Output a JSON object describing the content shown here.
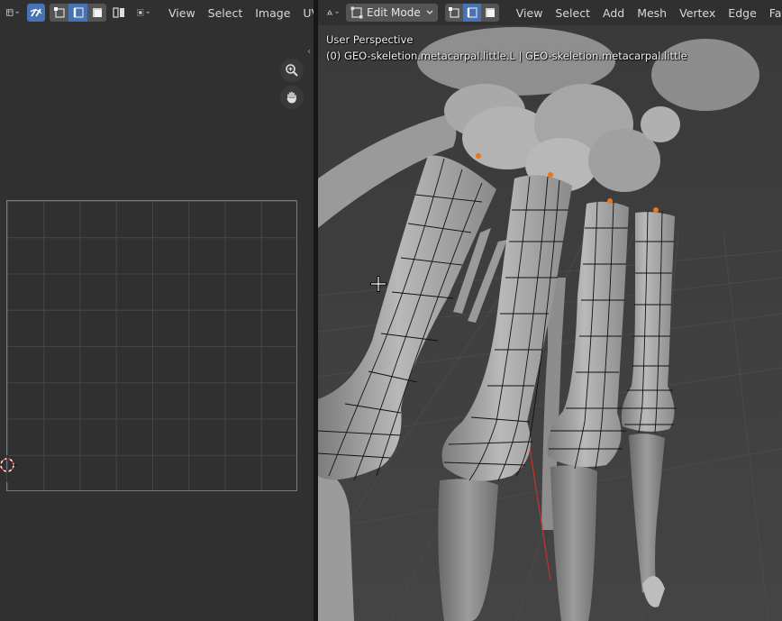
{
  "uv_editor": {
    "menus": [
      "View",
      "Select",
      "Image",
      "UV"
    ],
    "icons": {
      "editor_type": "uv-editor-icon",
      "sync": "uv-sync-icon",
      "select_modes": [
        "vertex-select-icon",
        "edge-select-icon",
        "face-select-icon",
        "island-select-icon"
      ],
      "sticky": "sticky-select-icon",
      "zoom": "zoom-icon",
      "pan": "hand-pan-icon"
    }
  },
  "viewport": {
    "mode": "Edit Mode",
    "menus": [
      "View",
      "Select",
      "Add",
      "Mesh",
      "Vertex",
      "Edge",
      "Face"
    ],
    "perspective_label": "User Perspective",
    "object_label": "(0) GEO-skeletion.metacarpal.little.L | GEO-skeletion.metacarpal.little"
  },
  "colors": {
    "accent": "#4772b3",
    "header_bg": "#303030",
    "viewport_bg": "#3d3d3d",
    "selected_vertex": "#e8761f"
  }
}
